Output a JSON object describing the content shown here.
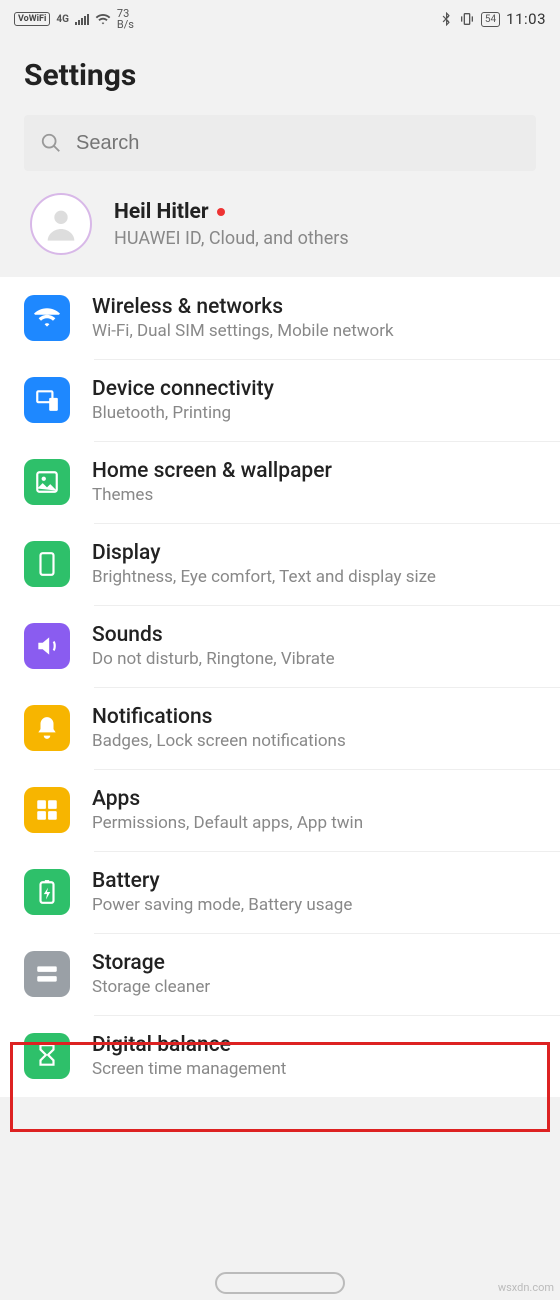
{
  "status": {
    "vowifi": "VoWiFi",
    "net": "4G",
    "rate_top": "73",
    "rate_bottom": "B/s",
    "battery": "54",
    "time": "11:03"
  },
  "title": "Settings",
  "search": {
    "placeholder": "Search"
  },
  "account": {
    "name": "Heil Hitler",
    "sub": "HUAWEI ID, Cloud, and others"
  },
  "items": [
    {
      "icon": "wifi",
      "color": "#1e88ff",
      "title": "Wireless & networks",
      "sub": "Wi-Fi, Dual SIM settings, Mobile network"
    },
    {
      "icon": "devices",
      "color": "#1e88ff",
      "title": "Device connectivity",
      "sub": "Bluetooth, Printing"
    },
    {
      "icon": "image",
      "color": "#2ec06a",
      "title": "Home screen & wallpaper",
      "sub": "Themes"
    },
    {
      "icon": "display",
      "color": "#2ec06a",
      "title": "Display",
      "sub": "Brightness, Eye comfort, Text and display size"
    },
    {
      "icon": "sound",
      "color": "#8a5cf0",
      "title": "Sounds",
      "sub": "Do not disturb, Ringtone, Vibrate"
    },
    {
      "icon": "bell",
      "color": "#f7b500",
      "title": "Notifications",
      "sub": "Badges, Lock screen notifications"
    },
    {
      "icon": "grid",
      "color": "#f7b500",
      "title": "Apps",
      "sub": "Permissions, Default apps, App twin",
      "highlighted": true
    },
    {
      "icon": "battery",
      "color": "#2ec06a",
      "title": "Battery",
      "sub": "Power saving mode, Battery usage"
    },
    {
      "icon": "storage",
      "color": "#9aa0a6",
      "title": "Storage",
      "sub": "Storage cleaner"
    },
    {
      "icon": "hourglass",
      "color": "#2ec06a",
      "title": "Digital balance",
      "sub": "Screen time management"
    }
  ],
  "watermark": "wsxdn.com"
}
